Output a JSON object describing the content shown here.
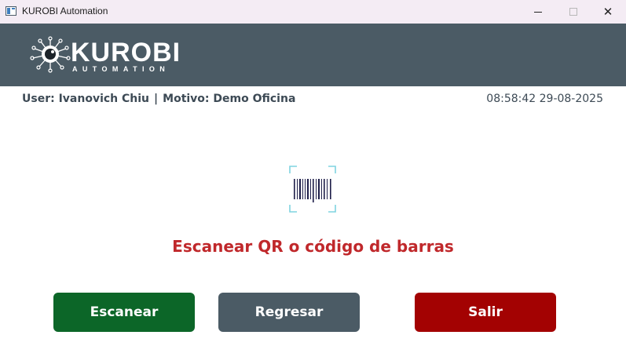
{
  "window": {
    "title": "KUROBI Automation",
    "minimize_icon": "minimize-icon",
    "maximize_icon": "maximize-icon",
    "close_icon": "close-icon"
  },
  "header": {
    "logo_name": "KUROBI",
    "logo_tagline": "AUTOMATION",
    "logo_icon": "eye-circuit-logo-icon",
    "background": "#4b5b65"
  },
  "session": {
    "user_label": "User: Ivanovich Chiu",
    "separator": "|",
    "reason_label": "Motivo: Demo Oficina",
    "datetime": "08:58:42 29-08-2025"
  },
  "scanner": {
    "icon": "barcode-scan-icon",
    "prompt": "Escanear QR o código de barras",
    "prompt_color": "#c0282b"
  },
  "actions": {
    "scan_label": "Escanear",
    "back_label": "Regresar",
    "exit_label": "Salir",
    "scan_color": "#0c6628",
    "back_color": "#4b5b65",
    "exit_color": "#a30202"
  }
}
